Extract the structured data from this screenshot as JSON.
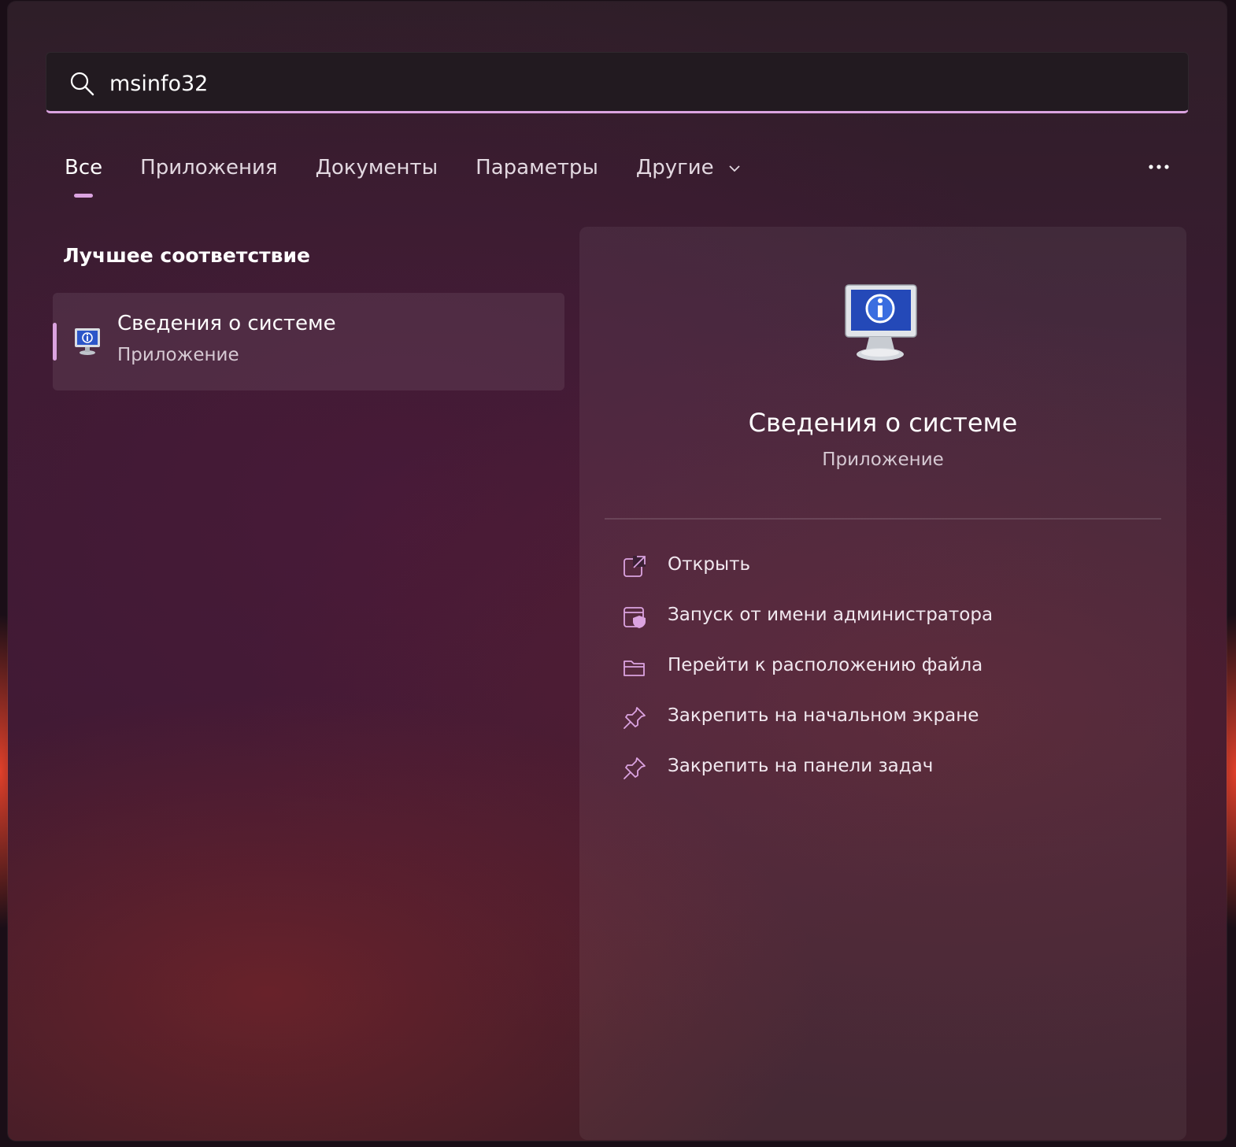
{
  "search": {
    "query": "msinfo32"
  },
  "tabs": [
    {
      "label": "Все",
      "active": true
    },
    {
      "label": "Приложения"
    },
    {
      "label": "Документы"
    },
    {
      "label": "Параметры"
    },
    {
      "label": "Другие"
    }
  ],
  "best_match": {
    "section_title": "Лучшее соответствие",
    "title": "Сведения о системе",
    "subtitle": "Приложение"
  },
  "details": {
    "title": "Сведения о системе",
    "subtitle": "Приложение",
    "actions": [
      {
        "label": "Открыть",
        "icon": "open-icon"
      },
      {
        "label": "Запуск от имени администратора",
        "icon": "admin-shield-icon"
      },
      {
        "label": "Перейти к расположению файла",
        "icon": "folder-icon"
      },
      {
        "label": "Закрепить на начальном экране",
        "icon": "pin-icon"
      },
      {
        "label": "Закрепить на панели задач",
        "icon": "pin-icon"
      }
    ]
  },
  "colors": {
    "accent": "#dba3e0",
    "text": "#ffffff",
    "subtext": "#d6c9d3"
  }
}
